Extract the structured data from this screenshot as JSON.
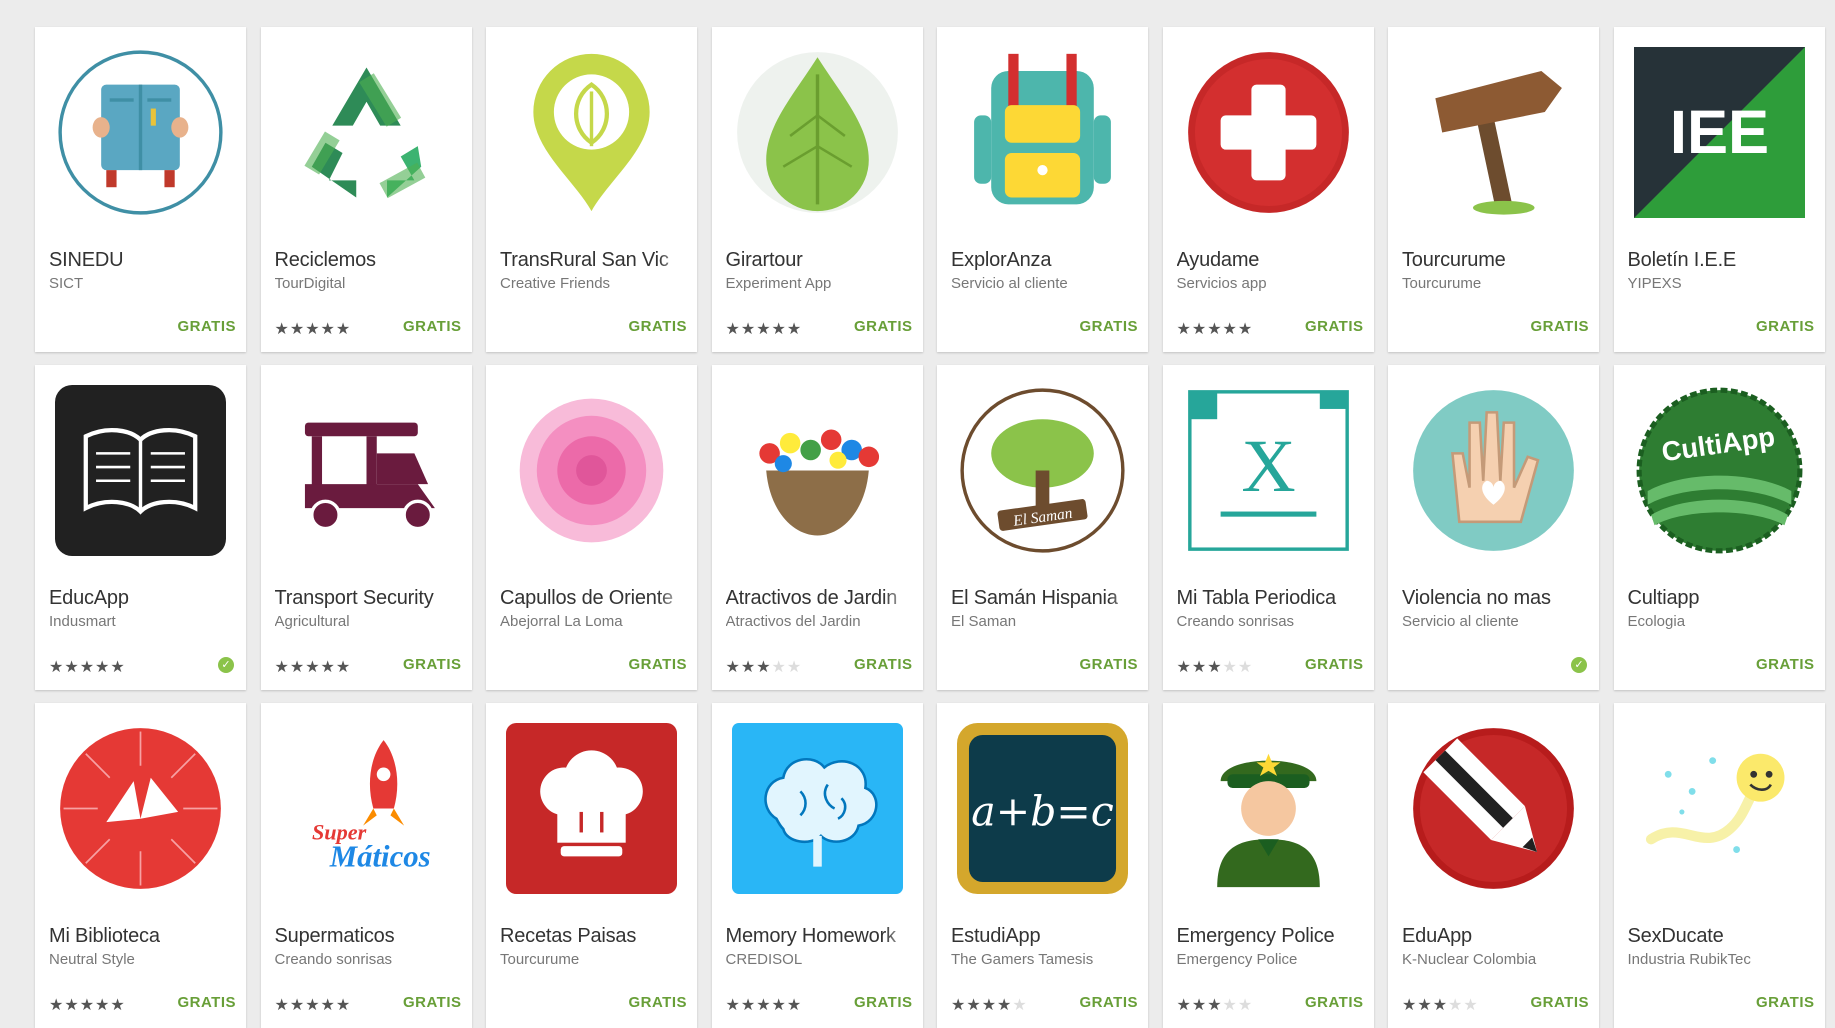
{
  "apps": [
    {
      "title": "SINEDU",
      "developer": "SICT",
      "price": "GRATIS",
      "rating": 0,
      "icon": "book-reader-icon"
    },
    {
      "title": "Reciclemos",
      "developer": "TourDigital",
      "price": "GRATIS",
      "rating": 5,
      "icon": "recycle-icon"
    },
    {
      "title": "TransRural San Vic",
      "developer": "Creative Friends",
      "price": "GRATIS",
      "rating": 0,
      "icon": "leaf-pin-icon"
    },
    {
      "title": "Girartour",
      "developer": "Experiment App",
      "price": "GRATIS",
      "rating": 5,
      "icon": "leaf-icon"
    },
    {
      "title": "ExplorAnza",
      "developer": "Servicio al cliente",
      "price": "GRATIS",
      "rating": 0,
      "icon": "backpack-icon"
    },
    {
      "title": "Ayudame",
      "developer": "Servicios app",
      "price": "GRATIS",
      "rating": 5,
      "icon": "medical-cross-icon"
    },
    {
      "title": "Tourcurume",
      "developer": "Tourcurume",
      "price": "GRATIS",
      "rating": 0,
      "icon": "signpost-icon"
    },
    {
      "title": "Boletín I.E.E",
      "developer": "YIPEXS",
      "price": "GRATIS",
      "rating": 0,
      "icon": "iee-logo-icon"
    },
    {
      "title": "EducApp",
      "developer": "Indusmart",
      "price": "",
      "installed": true,
      "rating": 5,
      "icon": "open-book-icon"
    },
    {
      "title": "Transport Security",
      "developer": "Agricultural",
      "price": "GRATIS",
      "rating": 5,
      "icon": "tuk-tuk-icon"
    },
    {
      "title": "Capullos de Oriente",
      "developer": "Abejorral La Loma",
      "price": "GRATIS",
      "rating": 0,
      "icon": "flower-icon"
    },
    {
      "title": "Atractivos de Jardin",
      "developer": "Atractivos del Jardin",
      "price": "GRATIS",
      "rating": 3,
      "icon": "flower-basket-icon"
    },
    {
      "title": "El Samán Hispania",
      "developer": "El Saman",
      "price": "GRATIS",
      "rating": 0,
      "icon": "tree-icon"
    },
    {
      "title": "Mi Tabla Periodica",
      "developer": "Creando sonrisas",
      "price": "GRATIS",
      "rating": 3,
      "icon": "element-x-icon"
    },
    {
      "title": "Violencia no mas",
      "developer": "Servicio al cliente",
      "price": "",
      "installed": true,
      "rating": 0,
      "icon": "hand-heart-icon"
    },
    {
      "title": "Cultiapp",
      "developer": "Ecologia",
      "price": "GRATIS",
      "rating": 0,
      "icon": "cultiapp-logo-icon"
    },
    {
      "title": "Mi Biblioteca",
      "developer": "Neutral Style",
      "price": "GRATIS",
      "rating": 5,
      "icon": "library-book-icon"
    },
    {
      "title": "Supermaticos",
      "developer": "Creando sonrisas",
      "price": "GRATIS",
      "rating": 5,
      "icon": "rocket-icon"
    },
    {
      "title": "Recetas Paisas",
      "developer": "Tourcurume",
      "price": "GRATIS",
      "rating": 0,
      "icon": "chef-hat-icon"
    },
    {
      "title": "Memory Homework",
      "developer": "CREDISOL",
      "price": "GRATIS",
      "rating": 5,
      "icon": "brain-icon"
    },
    {
      "title": "EstudiApp",
      "developer": "The Gamers Tamesis",
      "price": "GRATIS",
      "rating": 4.5,
      "icon": "chalkboard-icon"
    },
    {
      "title": "Emergency Police",
      "developer": "Emergency Police",
      "price": "GRATIS",
      "rating": 3,
      "icon": "police-officer-icon"
    },
    {
      "title": "EduApp",
      "developer": "K-Nuclear Colombia",
      "price": "GRATIS",
      "rating": 3,
      "icon": "pencil-icon"
    },
    {
      "title": "SexDucate",
      "developer": "Industria RubikTec",
      "price": "GRATIS",
      "rating": 0,
      "icon": "sperm-icon"
    }
  ],
  "icon_text": {
    "iee": "IEE",
    "cultiapp": "CultiApp",
    "saman": "El Saman",
    "supermaticos_1": "Super",
    "supermaticos_2": "Máticos",
    "formula": "a+b=c",
    "element": "X"
  },
  "colors": {
    "price_green": "#689f38",
    "installed_green": "#8bc34a"
  }
}
